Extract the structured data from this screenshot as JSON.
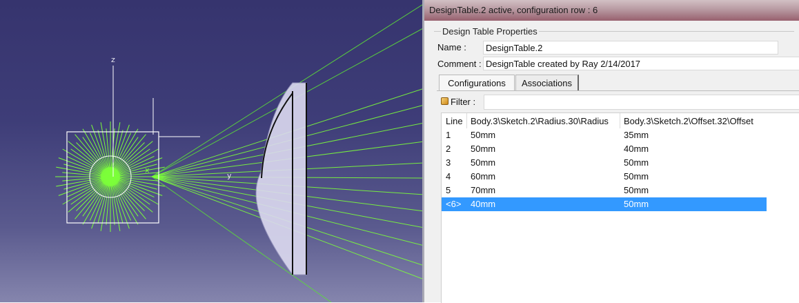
{
  "viewport": {
    "axis_labels": {
      "z": "z",
      "y": "y",
      "x": "x"
    },
    "colors": {
      "ray": "#7cff3a",
      "lens": "#dcdaf0",
      "frame": "#ffffff"
    }
  },
  "dialog": {
    "title": "DesignTable.2 active, configuration row : 6",
    "properties_group": {
      "title": "Design Table Properties",
      "name_label": "Name :",
      "name_value": "DesignTable.2",
      "comment_label": "Comment :",
      "comment_value": "DesignTable created by Ray 2/14/2017"
    },
    "tabs": [
      {
        "label": "Configurations",
        "active": true
      },
      {
        "label": "Associations",
        "active": false
      }
    ],
    "filter_label": "Filter :",
    "filter_value": "",
    "table": {
      "columns": [
        "Line",
        "Body.3\\Sketch.2\\Radius.30\\Radius",
        "Body.3\\Sketch.2\\Offset.32\\Offset"
      ],
      "rows": [
        {
          "line": "1",
          "radius": "50mm",
          "offset": "35mm",
          "selected": false
        },
        {
          "line": "2",
          "radius": "50mm",
          "offset": "40mm",
          "selected": false
        },
        {
          "line": "3",
          "radius": "50mm",
          "offset": "50mm",
          "selected": false
        },
        {
          "line": "4",
          "radius": "60mm",
          "offset": "50mm",
          "selected": false
        },
        {
          "line": "5",
          "radius": "70mm",
          "offset": "50mm",
          "selected": false
        },
        {
          "line": "<6>",
          "radius": "40mm",
          "offset": "50mm",
          "selected": true
        }
      ],
      "selection_color": "#3399ff"
    }
  }
}
